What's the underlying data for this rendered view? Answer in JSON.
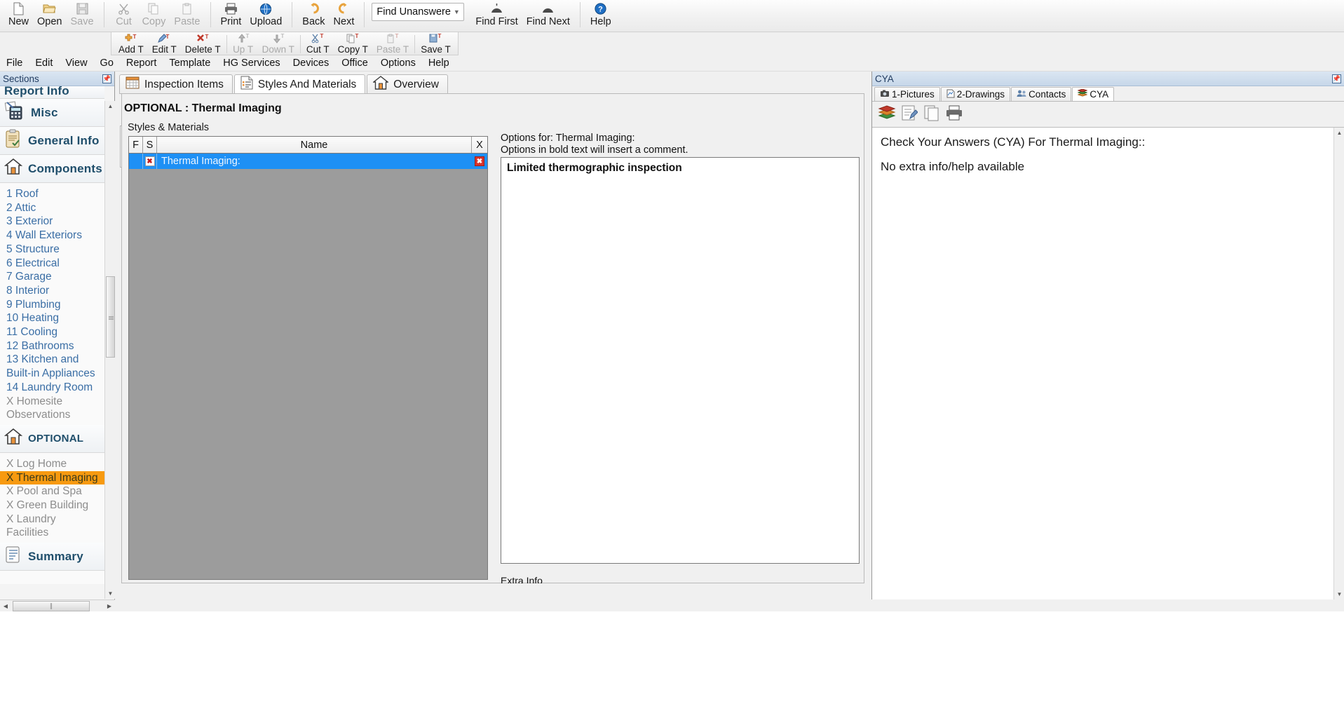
{
  "toolbar_top": {
    "groups": [
      {
        "buttons": [
          {
            "label": "New",
            "icon": "new-document-icon",
            "disabled": false
          },
          {
            "label": "Open",
            "icon": "open-folder-icon",
            "disabled": false
          },
          {
            "label": "Save",
            "icon": "save-disk-icon",
            "disabled": true
          }
        ]
      },
      {
        "buttons": [
          {
            "label": "Cut",
            "icon": "scissors-icon",
            "disabled": true
          },
          {
            "label": "Copy",
            "icon": "copy-icon",
            "disabled": true
          },
          {
            "label": "Paste",
            "icon": "paste-icon",
            "disabled": true
          }
        ]
      },
      {
        "buttons": [
          {
            "label": "Print",
            "icon": "printer-icon",
            "disabled": false
          },
          {
            "label": "Upload",
            "icon": "upload-globe-icon",
            "disabled": false
          }
        ]
      },
      {
        "buttons": [
          {
            "label": "Back",
            "icon": "back-arrow-icon",
            "disabled": false
          },
          {
            "label": "Next",
            "icon": "next-arrow-icon",
            "disabled": false
          }
        ]
      }
    ],
    "find_combo": {
      "value": "Find Unanswered",
      "arrow_icon": "chevron-down-icon"
    },
    "after_combo": [
      {
        "label": "Find First",
        "icon": "find-first-icon",
        "disabled": false
      },
      {
        "label": "Find Next",
        "icon": "find-next-icon",
        "disabled": false
      },
      {
        "label": "Help",
        "icon": "help-question-icon",
        "disabled": false
      }
    ]
  },
  "toolbar_second": {
    "groups": [
      {
        "buttons": [
          {
            "label": "Add T",
            "icon": "add-template-icon",
            "disabled": false
          },
          {
            "label": "Edit T",
            "icon": "edit-template-icon",
            "disabled": false
          },
          {
            "label": "Delete T",
            "icon": "delete-template-icon",
            "disabled": false
          }
        ]
      },
      {
        "buttons": [
          {
            "label": "Up T",
            "icon": "move-up-icon",
            "disabled": true
          },
          {
            "label": "Down T",
            "icon": "move-down-icon",
            "disabled": true
          }
        ]
      },
      {
        "buttons": [
          {
            "label": "Cut T",
            "icon": "cut-template-icon",
            "disabled": false
          },
          {
            "label": "Copy T",
            "icon": "copy-template-icon",
            "disabled": false
          },
          {
            "label": "Paste T",
            "icon": "paste-template-icon",
            "disabled": true
          }
        ]
      },
      {
        "buttons": [
          {
            "label": "Save T",
            "icon": "save-template-icon",
            "disabled": false
          }
        ]
      }
    ]
  },
  "menubar": {
    "items": [
      {
        "label": "File"
      },
      {
        "label": "Edit"
      },
      {
        "label": "View"
      },
      {
        "label": "Go"
      },
      {
        "label": "Report"
      },
      {
        "label": "Template"
      },
      {
        "label": "HG Services"
      },
      {
        "label": "Devices"
      },
      {
        "label": "Office"
      },
      {
        "label": "Options"
      },
      {
        "label": "Help"
      }
    ]
  },
  "sidebar": {
    "header": {
      "title": "Sections",
      "pin_icon": "pin-icon"
    },
    "bands": [
      {
        "label": "Report Info",
        "icon": "report-info-icon",
        "partial": true
      },
      {
        "label": "Misc",
        "icon": "calculator-icon",
        "partial": false
      },
      {
        "label": "General Info",
        "icon": "clipboard-icon",
        "partial": false
      },
      {
        "label": "Components",
        "icon": "house-icon",
        "partial": false
      }
    ],
    "components": [
      {
        "label": "1 Roof",
        "muted": false,
        "selected": false
      },
      {
        "label": "2 Attic",
        "muted": false,
        "selected": false
      },
      {
        "label": "3 Exterior",
        "muted": false,
        "selected": false
      },
      {
        "label": "4 Wall Exteriors",
        "muted": false,
        "selected": false
      },
      {
        "label": "5 Structure",
        "muted": false,
        "selected": false
      },
      {
        "label": "6 Electrical",
        "muted": false,
        "selected": false
      },
      {
        "label": "7 Garage",
        "muted": false,
        "selected": false
      },
      {
        "label": "8 Interior",
        "muted": false,
        "selected": false
      },
      {
        "label": "9 Plumbing",
        "muted": false,
        "selected": false
      },
      {
        "label": "10 Heating",
        "muted": false,
        "selected": false
      },
      {
        "label": "11 Cooling",
        "muted": false,
        "selected": false
      },
      {
        "label": "12 Bathrooms",
        "muted": false,
        "selected": false
      },
      {
        "label": "13 Kitchen and Built-in Appliances",
        "muted": false,
        "selected": false
      },
      {
        "label": "14 Laundry Room",
        "muted": false,
        "selected": false
      },
      {
        "label": "X Homesite Observations",
        "muted": true,
        "selected": false
      }
    ],
    "optional_band": {
      "label": "OPTIONAL",
      "icon": "house-icon"
    },
    "optional": [
      {
        "label": "X Log Home",
        "muted": true,
        "selected": false
      },
      {
        "label": "X Thermal Imaging",
        "muted": false,
        "selected": true
      },
      {
        "label": "X Pool and Spa",
        "muted": true,
        "selected": false
      },
      {
        "label": "X Green Building",
        "muted": true,
        "selected": false
      },
      {
        "label": "X Laundry Facilities",
        "muted": true,
        "selected": false
      }
    ],
    "summary_band": {
      "label": "Summary",
      "icon": "summary-icon"
    },
    "scroll": {
      "up_icon": "scroll-up-icon",
      "down_icon": "scroll-down-icon",
      "left_icon": "scroll-left-icon",
      "right_icon": "scroll-right-icon",
      "grip_icon": "grip-icon"
    }
  },
  "center": {
    "tabs": [
      {
        "label": "Inspection Items",
        "icon": "grid-table-icon",
        "active": false
      },
      {
        "label": "Styles And Materials",
        "icon": "list-document-icon",
        "active": true
      },
      {
        "label": "Overview",
        "icon": "house-icon",
        "active": false
      }
    ],
    "section_title": "OPTIONAL : Thermal Imaging",
    "subsection_label": "Styles & Materials",
    "grid": {
      "columns": [
        {
          "key": "f",
          "label": "F"
        },
        {
          "key": "s",
          "label": "S"
        },
        {
          "key": "name",
          "label": "Name"
        },
        {
          "key": "x",
          "label": "X"
        }
      ],
      "rows": [
        {
          "f": "",
          "s": "x-mark",
          "name": "Thermal Imaging:",
          "x": "x-mark",
          "selected": true
        }
      ]
    },
    "options_header_line1": "Options for: Thermal Imaging:",
    "options_header_line2": "Options in bold text will insert a comment.",
    "options": [
      {
        "label": "Limited thermographic inspection",
        "bold": true
      }
    ],
    "extra_info_label": "Extra Info",
    "extra_info_value": ""
  },
  "rightpanel": {
    "header": {
      "title": "CYA",
      "pin_icon": "pin-icon"
    },
    "tabs": [
      {
        "label": "1-Pictures",
        "icon": "camera-icon",
        "active": false
      },
      {
        "label": "2-Drawings",
        "icon": "drawing-icon",
        "active": false
      },
      {
        "label": "Contacts",
        "icon": "contacts-icon",
        "active": false
      },
      {
        "label": "CYA",
        "icon": "books-icon",
        "active": true
      }
    ],
    "toolbar": [
      {
        "icon": "books-stack-icon",
        "name": "cya-books-button"
      },
      {
        "icon": "edit-note-icon",
        "name": "cya-edit-button"
      },
      {
        "icon": "copy-page-icon",
        "name": "cya-copy-button"
      },
      {
        "icon": "printer-icon",
        "name": "cya-print-button"
      }
    ],
    "body_paragraphs": [
      "Check Your Answers (CYA) For Thermal Imaging::",
      "No extra info/help available"
    ],
    "scroll": {
      "up_icon": "scroll-up-icon",
      "down_icon": "scroll-down-icon"
    }
  },
  "colors": {
    "selection_blue": "#1e90f5",
    "highlight_orange": "#f79a10",
    "grid_background": "#9c9c9c",
    "link_blue": "#3a6ea5",
    "band_text": "#1f4e6b"
  }
}
